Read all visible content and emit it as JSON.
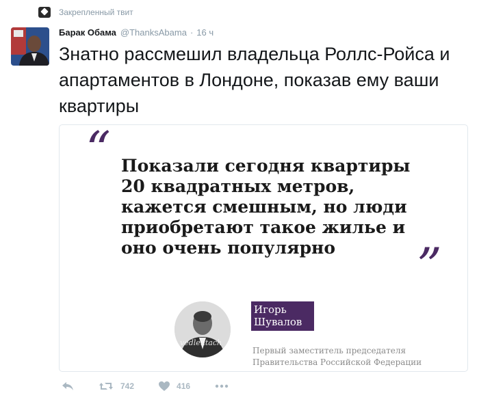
{
  "pinned": {
    "label": "Закрепленный твит"
  },
  "tweet": {
    "author": "Барак Обама",
    "handle": "@ThanksAbama",
    "separator": "·",
    "time": "16 ч",
    "text": "Знатно рассмешил владельца Роллс-Ройса и апартаментов в Лондоне, показав ему ваши квартиры"
  },
  "card": {
    "quote_open": "“",
    "quote_close": "”",
    "quote": "Показали сегодня квартиры 20 квадратных метров, кажется смешным, но люди приобретают такое жилье и оно очень популярно",
    "watermark": "vedlentach",
    "name": "Игорь Шувалов",
    "position": "Первый заместитель председателя Правительства Российской Федерации",
    "accent_color": "#4b2a63"
  },
  "actions": {
    "retweet_count": "742",
    "like_count": "416",
    "icons": [
      "reply-icon",
      "retweet-icon",
      "like-icon",
      "more-icon"
    ]
  }
}
